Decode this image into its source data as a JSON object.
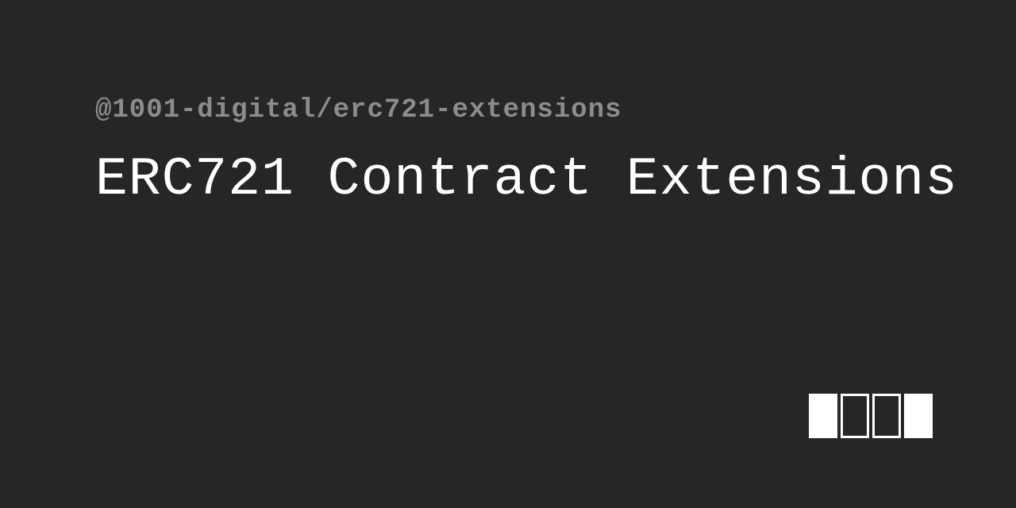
{
  "package": {
    "name": "@1001-digital/erc721-extensions"
  },
  "title": "ERC721 Contract Extensions",
  "logo": {
    "bars": [
      "filled",
      "outlined",
      "outlined",
      "filled"
    ]
  }
}
